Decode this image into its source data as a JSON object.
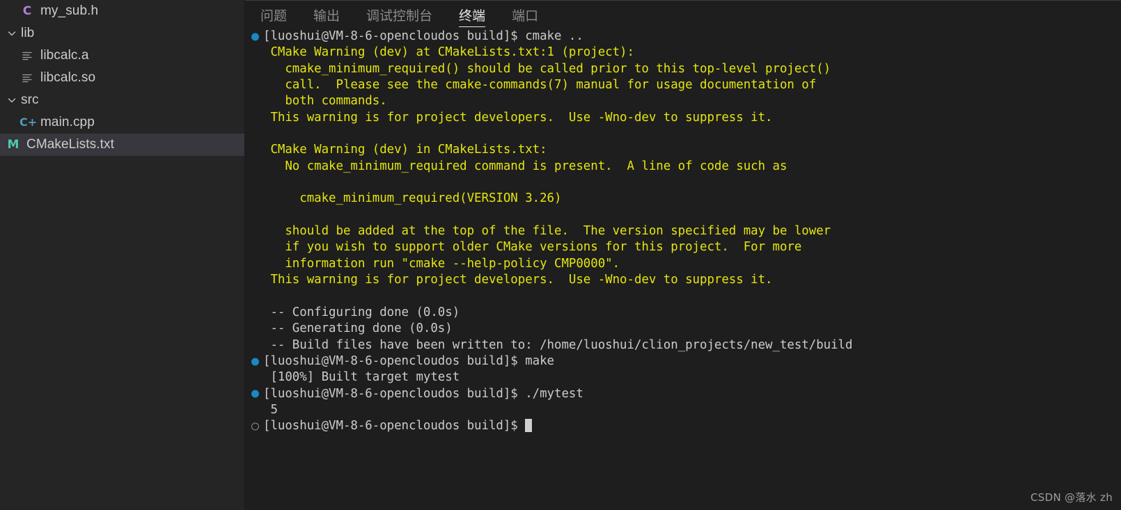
{
  "colors": {
    "editor_bg": "#1e1e1e",
    "sidebar_bg": "#252526",
    "selection_bg": "#37373d",
    "terminal_fg": "#cccccc",
    "terminal_yellow": "#e5e510",
    "command_decoration": "#1b87c4",
    "tab_active_fg": "#e7e7e7",
    "tab_inactive_fg": "#8a8a8a"
  },
  "sidebar": {
    "items": [
      {
        "label": "my_sub.h",
        "icon": "c-header-file-icon",
        "icon_glyph": "C",
        "indent": 1,
        "type": "file",
        "selected": false,
        "expanded": null
      },
      {
        "label": "lib",
        "icon": "chevron-down-icon",
        "icon_glyph": "",
        "indent": 0,
        "type": "folder",
        "selected": false,
        "expanded": true
      },
      {
        "label": "libcalc.a",
        "icon": "binary-file-icon",
        "icon_glyph": "",
        "indent": 1,
        "type": "file",
        "selected": false,
        "expanded": null
      },
      {
        "label": "libcalc.so",
        "icon": "binary-file-icon",
        "icon_glyph": "",
        "indent": 1,
        "type": "file",
        "selected": false,
        "expanded": null
      },
      {
        "label": "src",
        "icon": "chevron-down-icon",
        "icon_glyph": "",
        "indent": 0,
        "type": "folder",
        "selected": false,
        "expanded": true
      },
      {
        "label": "main.cpp",
        "icon": "cpp-file-icon",
        "icon_glyph": "C+",
        "indent": 1,
        "type": "file",
        "selected": false,
        "expanded": null
      },
      {
        "label": "CMakeLists.txt",
        "icon": "cmake-file-icon",
        "icon_glyph": "M",
        "indent": 0,
        "type": "file",
        "selected": true,
        "expanded": null
      }
    ]
  },
  "panel": {
    "tabs": [
      {
        "label": "问题",
        "active": false
      },
      {
        "label": "输出",
        "active": false
      },
      {
        "label": "调试控制台",
        "active": false
      },
      {
        "label": "终端",
        "active": true
      },
      {
        "label": "端口",
        "active": false
      }
    ]
  },
  "terminal": {
    "lines": [
      {
        "deco": "cmd-ok",
        "color": "white",
        "text": "[luoshui@VM-8-6-opencloudos build]$ cmake .."
      },
      {
        "deco": null,
        "color": "yellow",
        "text": " CMake Warning (dev) at CMakeLists.txt:1 (project):"
      },
      {
        "deco": null,
        "color": "yellow",
        "text": "   cmake_minimum_required() should be called prior to this top-level project()"
      },
      {
        "deco": null,
        "color": "yellow",
        "text": "   call.  Please see the cmake-commands(7) manual for usage documentation of"
      },
      {
        "deco": null,
        "color": "yellow",
        "text": "   both commands."
      },
      {
        "deco": null,
        "color": "yellow",
        "text": " This warning is for project developers.  Use -Wno-dev to suppress it."
      },
      {
        "deco": null,
        "color": "yellow",
        "text": ""
      },
      {
        "deco": null,
        "color": "yellow",
        "text": " CMake Warning (dev) in CMakeLists.txt:"
      },
      {
        "deco": null,
        "color": "yellow",
        "text": "   No cmake_minimum_required command is present.  A line of code such as"
      },
      {
        "deco": null,
        "color": "yellow",
        "text": ""
      },
      {
        "deco": null,
        "color": "yellow",
        "text": "     cmake_minimum_required(VERSION 3.26)"
      },
      {
        "deco": null,
        "color": "yellow",
        "text": ""
      },
      {
        "deco": null,
        "color": "yellow",
        "text": "   should be added at the top of the file.  The version specified may be lower"
      },
      {
        "deco": null,
        "color": "yellow",
        "text": "   if you wish to support older CMake versions for this project.  For more"
      },
      {
        "deco": null,
        "color": "yellow",
        "text": "   information run \"cmake --help-policy CMP0000\"."
      },
      {
        "deco": null,
        "color": "yellow",
        "text": " This warning is for project developers.  Use -Wno-dev to suppress it."
      },
      {
        "deco": null,
        "color": "white",
        "text": ""
      },
      {
        "deco": null,
        "color": "white",
        "text": " -- Configuring done (0.0s)"
      },
      {
        "deco": null,
        "color": "white",
        "text": " -- Generating done (0.0s)"
      },
      {
        "deco": null,
        "color": "white",
        "text": " -- Build files have been written to: /home/luoshui/clion_projects/new_test/build"
      },
      {
        "deco": "cmd-ok",
        "color": "white",
        "text": "[luoshui@VM-8-6-opencloudos build]$ make"
      },
      {
        "deco": null,
        "color": "white",
        "text": " [100%] Built target mytest"
      },
      {
        "deco": "cmd-ok",
        "color": "white",
        "text": "[luoshui@VM-8-6-opencloudos build]$ ./mytest"
      },
      {
        "deco": null,
        "color": "white",
        "text": " 5"
      },
      {
        "deco": "cmd-current",
        "color": "white",
        "text": "[luoshui@VM-8-6-opencloudos build]$ ",
        "cursor": true
      }
    ]
  },
  "watermark": {
    "text": "CSDN @落水 zh"
  }
}
